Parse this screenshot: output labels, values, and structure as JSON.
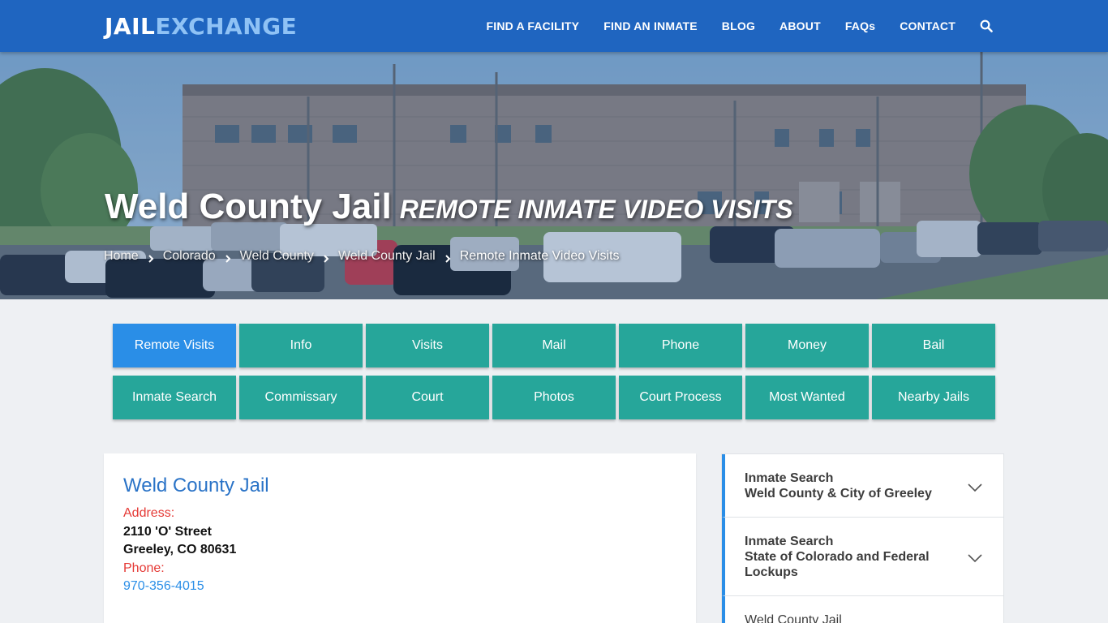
{
  "header": {
    "logo_part1": "JAIL",
    "logo_part2": "EXCHANGE",
    "nav": [
      "FIND A FACILITY",
      "FIND AN INMATE",
      "BLOG",
      "ABOUT",
      "FAQs",
      "CONTACT"
    ],
    "search_icon": "search-icon"
  },
  "hero": {
    "title": "Weld County Jail",
    "subtitle": "REMOTE INMATE VIDEO VISITS",
    "breadcrumb": [
      "Home",
      "Colorado",
      "Weld County",
      "Weld County Jail"
    ],
    "breadcrumb_current": "Remote Inmate Video Visits"
  },
  "tabs": {
    "row1": [
      "Remote Visits",
      "Info",
      "Visits",
      "Mail",
      "Phone",
      "Money",
      "Bail"
    ],
    "row2": [
      "Inmate Search",
      "Commissary",
      "Court",
      "Photos",
      "Court Process",
      "Most Wanted",
      "Nearby Jails"
    ],
    "active": "Remote Visits"
  },
  "facility": {
    "name": "Weld County Jail",
    "address_label": "Address:",
    "address_line1": "2110 'O' Street",
    "address_line2": "Greeley, CO 80631",
    "phone_label": "Phone:",
    "phone": "970-356-4015"
  },
  "sidebar": {
    "items": [
      {
        "line1": "Inmate Search",
        "line2": "Weld County & City of Greeley"
      },
      {
        "line1": "Inmate Search",
        "line2": "State of Colorado and Federal Lockups"
      },
      {
        "line1": "Weld County Jail",
        "line2": ""
      }
    ]
  },
  "colors": {
    "header_bg": "#1f65c0",
    "logo_accent": "#8fc2f5",
    "tab_bg": "#26a69a",
    "tab_active_bg": "#2a8ee7",
    "link_blue": "#2a73c7",
    "label_red": "#e53935"
  }
}
